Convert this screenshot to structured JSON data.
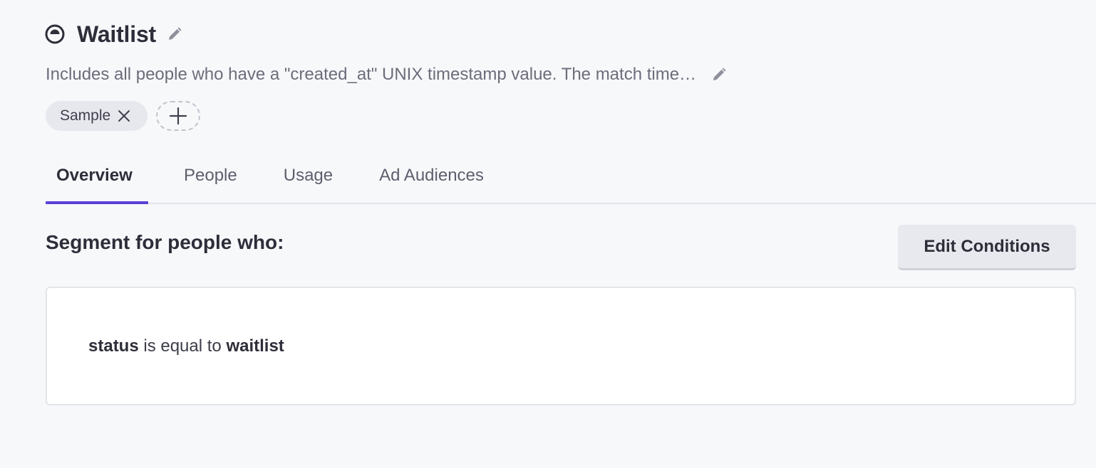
{
  "segment": {
    "icon": "segment-icon",
    "title": "Waitlist",
    "description": "Includes all people who have a \"created_at\" UNIX timestamp value. The match time…",
    "tags": [
      {
        "label": "Sample"
      }
    ]
  },
  "tabs": [
    {
      "label": "Overview",
      "active": true
    },
    {
      "label": "People",
      "active": false
    },
    {
      "label": "Usage",
      "active": false
    },
    {
      "label": "Ad Audiences",
      "active": false
    }
  ],
  "overview": {
    "heading": "Segment for people who:",
    "edit_button": "Edit Conditions",
    "condition": {
      "attribute": "status",
      "operator": "is equal to",
      "value": "waitlist"
    }
  },
  "colors": {
    "accent": "#5b3fd6",
    "background": "#f7f8fa",
    "tag_bg": "#e7e8ee"
  }
}
